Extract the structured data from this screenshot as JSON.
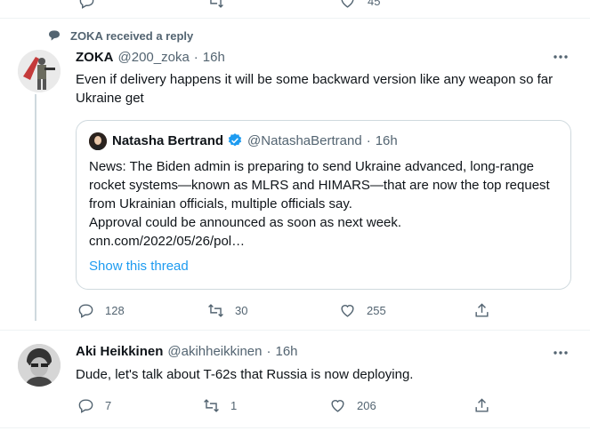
{
  "top_actions": {
    "reply": "",
    "retweet": "",
    "like": "45"
  },
  "context": {
    "text": "ZOKA received a reply"
  },
  "reply_tweet": {
    "name": "ZOKA",
    "handle": "@200_zoka",
    "separator": "·",
    "time": "16h",
    "text": "Even if delivery happens it will be some backward version like any weapon so far Ukraine get"
  },
  "quoted_tweet": {
    "name": "Natasha Bertrand",
    "handle": "@NatashaBertrand",
    "separator": "·",
    "time": "16h",
    "text": "News: The Biden admin is preparing to send Ukraine advanced, long-range rocket systems—known as MLRS and HIMARS—that are now the top request from Ukrainian officials, multiple officials say.\nApproval could be announced as soon as next week.\ncnn.com/2022/05/26/pol…",
    "show_thread": "Show this thread"
  },
  "reply_stats": {
    "replies": "128",
    "retweets": "30",
    "likes": "255"
  },
  "second_tweet": {
    "name": "Aki Heikkinen",
    "handle": "@akihheikkinen",
    "separator": "·",
    "time": "16h",
    "text": "Dude, let's talk about T-62s that Russia is now deploying."
  },
  "second_stats": {
    "replies": "7",
    "retweets": "1",
    "likes": "206"
  },
  "colors": {
    "accent": "#1d9bf0",
    "muted": "#536471",
    "border": "#cfd9de"
  }
}
